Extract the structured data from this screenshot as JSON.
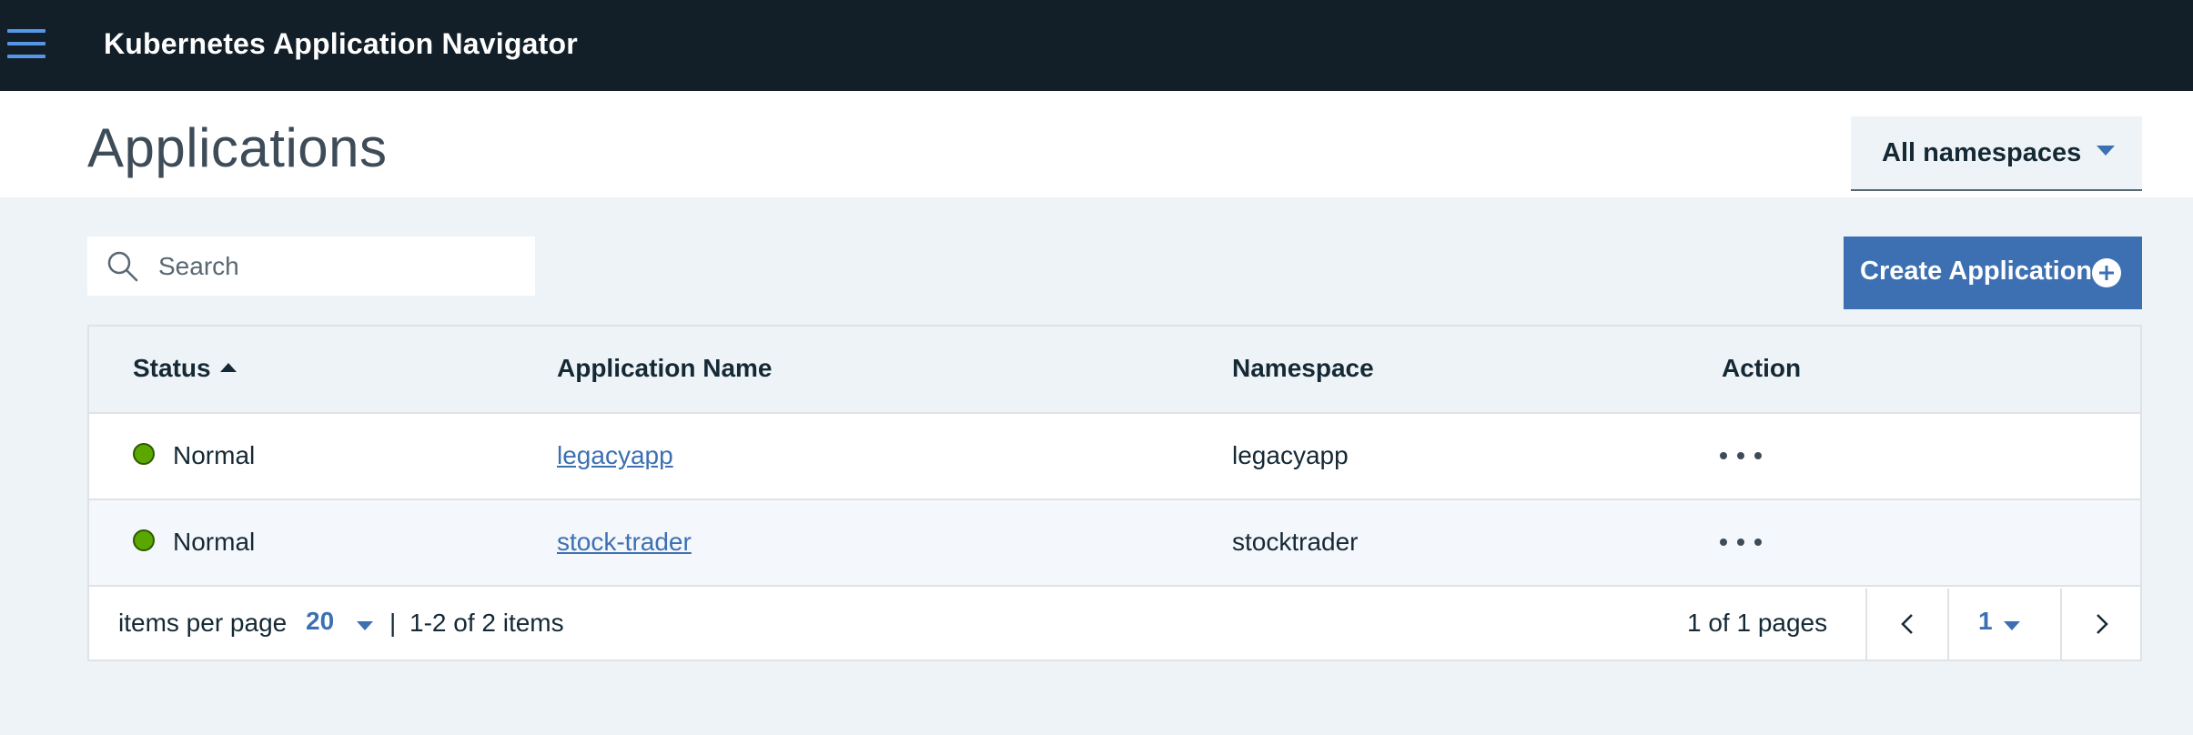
{
  "topbar": {
    "menu_icon": "hamburger-menu-icon",
    "title": "Kubernetes Application Navigator"
  },
  "page": {
    "title": "Applications"
  },
  "namespace_select": {
    "value": "All namespaces"
  },
  "search": {
    "placeholder": "Search",
    "value": ""
  },
  "toolbar": {
    "create_label": "Create Application",
    "create_icon": "add-circle-icon"
  },
  "table": {
    "columns": [
      "Status",
      "Application Name",
      "Namespace",
      "Action"
    ],
    "sort": {
      "column": "Status",
      "direction": "ascending"
    },
    "rows": [
      {
        "status": "Normal",
        "name": "legacyapp",
        "namespace": "legacyapp",
        "action_icon": "overflow-menu-icon"
      },
      {
        "status": "Normal",
        "name": "stock-trader",
        "namespace": "stocktrader",
        "action_icon": "overflow-menu-icon"
      }
    ]
  },
  "pagination": {
    "items_per_page_label": "items per page",
    "items_per_page": "20",
    "separator": "|",
    "range_text": "1-2 of 2 items",
    "pages_text": "1 of 1 pages",
    "current_page": "1"
  },
  "colors": {
    "topbar_bg": "#121f28",
    "accent": "#3d70b2",
    "status_normal": "#5aa700",
    "page_bg": "#eef3f7"
  }
}
